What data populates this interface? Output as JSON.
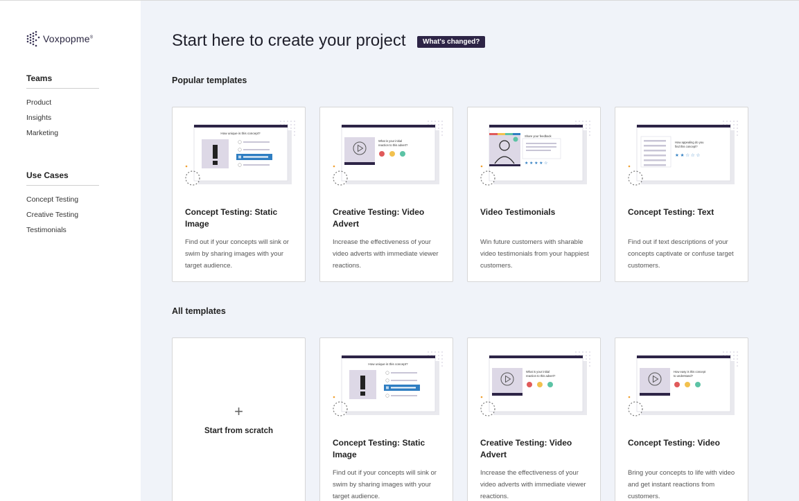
{
  "brand": {
    "name": "Voxpopme",
    "mark": "®"
  },
  "sidebar": {
    "teams": {
      "heading": "Teams",
      "items": [
        {
          "label": "Product"
        },
        {
          "label": "Insights"
        },
        {
          "label": "Marketing"
        }
      ]
    },
    "use_cases": {
      "heading": "Use Cases",
      "items": [
        {
          "label": "Concept Testing"
        },
        {
          "label": "Creative Testing"
        },
        {
          "label": "Testimonials"
        }
      ]
    }
  },
  "header": {
    "title": "Start here to create your project",
    "whats_changed": "What's changed?"
  },
  "popular": {
    "heading": "Popular templates",
    "cards": [
      {
        "title": "Concept Testing: Static Image",
        "desc": "Find out if your concepts will sink or swim by sharing images with your target audience.",
        "illus": {
          "kind": "static",
          "question": "How unique is this concept?"
        }
      },
      {
        "title": "Creative Testing: Video Advert",
        "desc": "Increase the effectiveness of your video adverts with immediate viewer reactions.",
        "illus": {
          "kind": "video",
          "q1": "What is your initial",
          "q2": "reaction to this advert?"
        }
      },
      {
        "title": "Video Testimonials",
        "desc": "Win future customers with sharable video testimonials from your happiest customers.",
        "illus": {
          "kind": "testimonial",
          "question": "Share your feedback"
        }
      },
      {
        "title": "Concept Testing: Text",
        "desc": "Find out if text descriptions of your concepts captivate or confuse target customers.",
        "illus": {
          "kind": "text",
          "q1": "How appealing do you",
          "q2": "find this concept?"
        }
      }
    ]
  },
  "all": {
    "heading": "All templates",
    "scratch": {
      "plus": "+",
      "label": "Start from scratch"
    },
    "cards": [
      {
        "title": "Concept Testing: Static Image",
        "desc": "Find out if your concepts will sink or swim by sharing images with your target audience.",
        "illus": {
          "kind": "static",
          "question": "How unique is this concept?"
        }
      },
      {
        "title": "Creative Testing: Video Advert",
        "desc": "Increase the effectiveness of your video adverts with immediate viewer reactions.",
        "illus": {
          "kind": "video",
          "q1": "What is your initial",
          "q2": "reaction to this advert?"
        }
      },
      {
        "title": "Concept Testing: Video",
        "desc": "Bring your concepts to life with video and get instant reactions from customers.",
        "illus": {
          "kind": "video",
          "q1": "How easy is this concept",
          "q2": "to understand?"
        }
      }
    ]
  },
  "colors": {
    "accent": "#2d2446",
    "background": "#f0f3f9",
    "highlight": "#2f7ec2",
    "red": "#e05a5a",
    "yellow": "#f2c14e",
    "green": "#5cc3a5"
  }
}
